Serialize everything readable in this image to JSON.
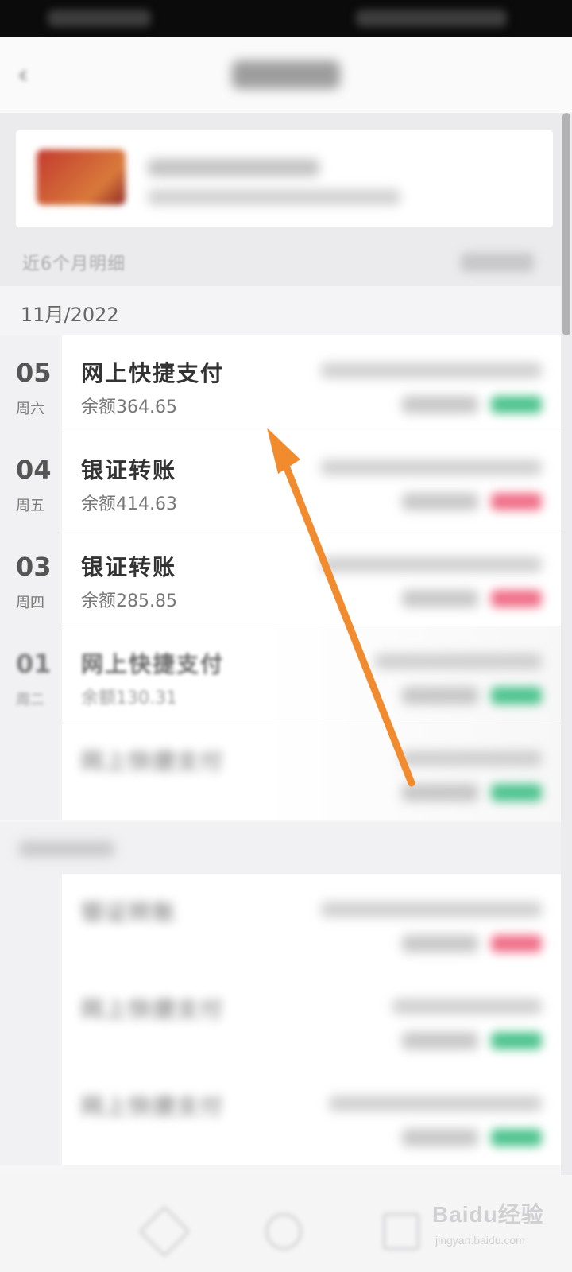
{
  "header": {
    "back_icon": "back-arrow-icon"
  },
  "filter": {
    "range_label": "近6个月明细"
  },
  "month_group": {
    "label": "11月/2022"
  },
  "transactions": [
    {
      "day": "05",
      "weekday": "周六",
      "title": "网上快捷支付",
      "balance": "余额364.65",
      "amount_color": "#4fc48f"
    },
    {
      "day": "04",
      "weekday": "周五",
      "title": "银证转账",
      "balance": "余额414.63",
      "amount_color": "#f0708a"
    },
    {
      "day": "03",
      "weekday": "周四",
      "title": "银证转账",
      "balance": "余额285.85",
      "amount_color": "#f0708a"
    },
    {
      "day": "01",
      "weekday": "周二",
      "title": "网上快捷支付",
      "balance": "余额130.31",
      "amount_color": "#4fc48f"
    },
    {
      "day": "",
      "weekday": "",
      "title": "网上快捷支付",
      "balance": "",
      "amount_color": "#4fc48f"
    }
  ],
  "blurred_transactions": [
    {
      "title": "银证转账",
      "amount_color": "#f0708a"
    },
    {
      "title": "网上快捷支付",
      "amount_color": "#4fc48f"
    },
    {
      "title": "网上快捷支付",
      "amount_color": "#4fc48f"
    }
  ],
  "annotation": {
    "arrow_color": "#f28a2e"
  },
  "watermark": {
    "brand": "Baidu经验",
    "url": "jingyan.baidu.com"
  }
}
